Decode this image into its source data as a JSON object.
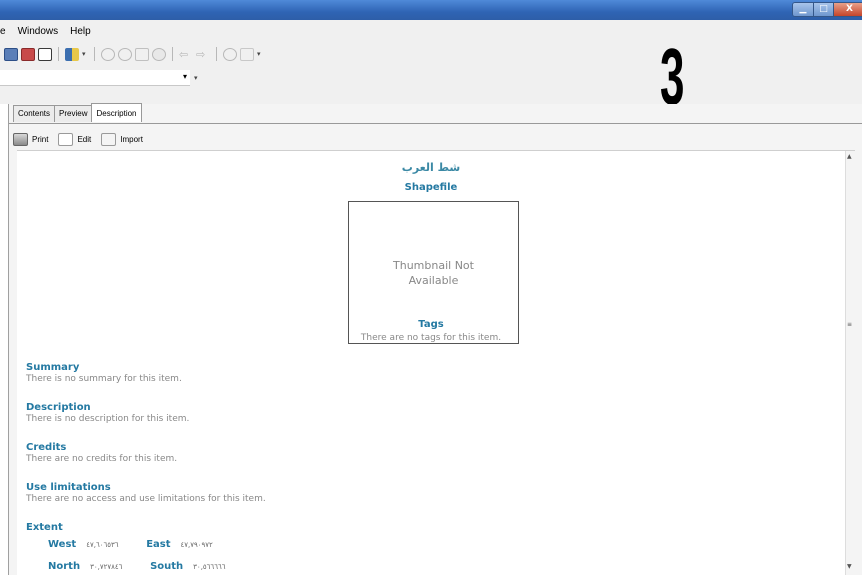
{
  "window": {
    "minimize_glyph": "▁",
    "maximize_glyph": "□",
    "close_glyph": "X"
  },
  "menu": {
    "items": [
      "e",
      "Windows",
      "Help"
    ]
  },
  "toolbar": {
    "icons": [
      "catalog-icon",
      "connect-icon",
      "window-icon",
      "python-icon",
      "zoom-in-icon",
      "zoom-out-icon",
      "pan-icon",
      "full-extent-icon",
      "back-icon",
      "forward-icon",
      "identify-icon",
      "create-thumbnail-icon"
    ],
    "dropdown_glyph": "▾"
  },
  "location": {
    "value": "",
    "arrow_glyph": "▾"
  },
  "overlay_number": "3",
  "tabs": [
    "Contents",
    "Preview",
    "Description"
  ],
  "active_tab": "Description",
  "actions": {
    "print": "Print",
    "edit": "Edit",
    "import": "Import"
  },
  "document": {
    "item_title": "شط العرب",
    "item_type": "Shapefile",
    "thumbnail_text": "Thumbnail Not Available",
    "tags_heading": "Tags",
    "tags_text": "There are no tags for this item.",
    "sections": [
      {
        "heading": "Summary",
        "text": "There is no summary for this item."
      },
      {
        "heading": "Description",
        "text": "There is no description for this item."
      },
      {
        "heading": "Credits",
        "text": "There are no credits for this item."
      },
      {
        "heading": "Use limitations",
        "text": "There are no access and use limitations for this item."
      }
    ],
    "extent": {
      "heading": "Extent",
      "west_label": "West",
      "west_value": "٤٧,٦٠٦٥٣٦",
      "east_label": "East",
      "east_value": "٤٧,٧٩٠٩٧٢",
      "north_label": "North",
      "north_value": "٣٠,٧٢٧٨٤٦",
      "south_label": "South",
      "south_value": "٣٠,٥٦٦٦٦٦"
    }
  },
  "scrollbar": {
    "up_glyph": "▲",
    "grip_glyph": "≡",
    "down_glyph": "▼"
  },
  "colors": {
    "heading": "#2479a2",
    "muted_text": "#888888",
    "titlebar": "#2f64b4"
  }
}
